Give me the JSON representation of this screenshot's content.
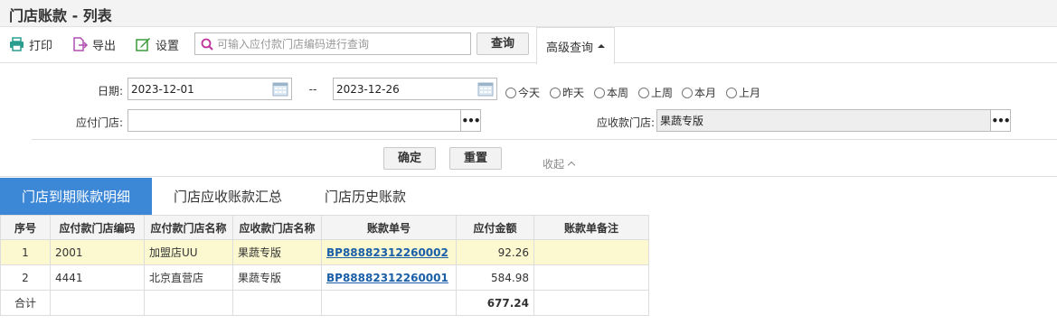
{
  "page": {
    "title": "门店账款 - 列表"
  },
  "toolbar": {
    "print_label": "打印",
    "export_label": "导出",
    "settings_label": "设置",
    "search_placeholder": "可输入应付款门店编码进行查询",
    "search_value": "",
    "query_label": "查询",
    "advanced_label": "高级查询"
  },
  "filter": {
    "date_label": "日期:",
    "date_from": "2023-12-01",
    "date_sep": "--",
    "date_to": "2023-12-26",
    "quick": [
      "今天",
      "昨天",
      "本周",
      "上周",
      "本月",
      "上月"
    ],
    "pay_store_label": "应付门店:",
    "pay_store_value": "",
    "recv_store_label": "应收款门店:",
    "recv_store_value": "果蔬专版",
    "confirm_label": "确定",
    "reset_label": "重置",
    "collapse_label": "收起"
  },
  "tabs": [
    "门店到期账款明细",
    "门店应收账款汇总",
    "门店历史账款"
  ],
  "table": {
    "headers": [
      "序号",
      "应付款门店编码",
      "应付款门店名称",
      "应收款门店名称",
      "账款单号",
      "应付金额",
      "账款单备注"
    ],
    "rows": [
      [
        "1",
        "2001",
        "加盟店UU",
        "果蔬专版",
        "BP88882312260002",
        "92.26",
        ""
      ],
      [
        "2",
        "4441",
        "北京直营店",
        "果蔬专版",
        "BP88882312260001",
        "584.98",
        ""
      ]
    ],
    "total_label": "合计",
    "total_amount": "677.24"
  },
  "colors": {
    "accent": "#3c87d6",
    "highlight_row": "#fcf8cf",
    "link": "#1a5fa8"
  }
}
